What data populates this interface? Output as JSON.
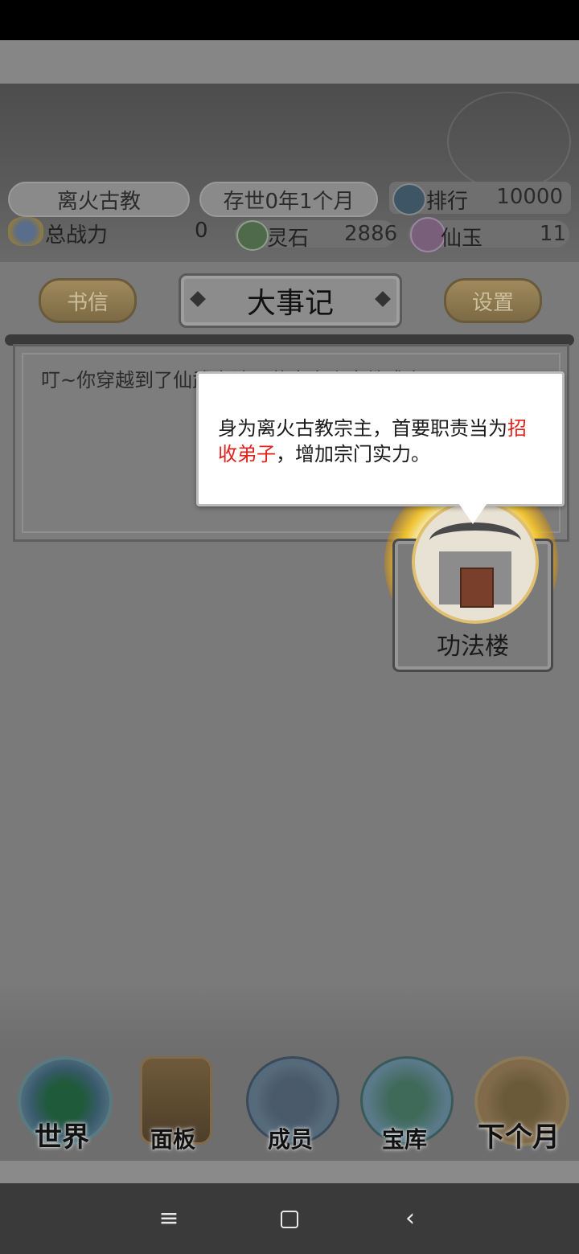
{
  "header": {
    "sect_name": "离火古教",
    "existence": "存世0年1个月",
    "rank_label": "排行",
    "rank_value": "10000",
    "power_label": "总战力",
    "power_value": "0",
    "spirit_stone_label": "灵石",
    "spirit_stone_value": "2886",
    "jade_label": "仙玉",
    "jade_value": "11"
  },
  "toolbar": {
    "mail_label": "书信",
    "title": "大事记",
    "settings_label": "设置"
  },
  "log": {
    "entry": "叮~你穿越到了仙武大陆，恭喜离火古教成立！"
  },
  "tutorial": {
    "text_before": "身为离火古教宗主，首要职责当为",
    "highlight": "招收弟子",
    "text_after": "，增加宗门实力。",
    "highlight_color": "#e2201c"
  },
  "building": {
    "label": "功法楼"
  },
  "nav": [
    {
      "label": "世界"
    },
    {
      "label": "面板"
    },
    {
      "label": "成员"
    },
    {
      "label": "宝库"
    },
    {
      "label": "下个月"
    }
  ],
  "system_nav": {
    "menu_icon": "≡",
    "back_icon": "‹"
  }
}
